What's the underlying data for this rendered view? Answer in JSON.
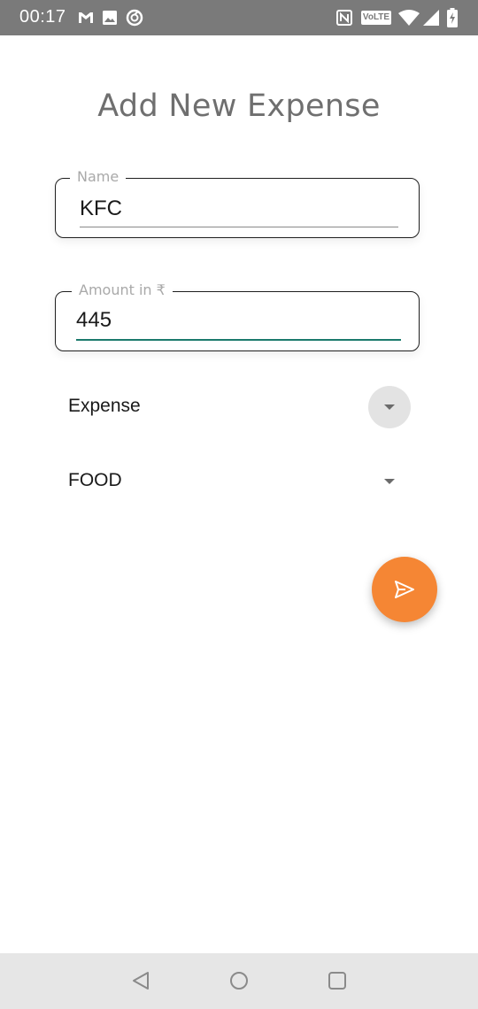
{
  "status_bar": {
    "time": "00:17",
    "volte": "VoLTE",
    "icons": [
      "gmail-icon",
      "image-icon",
      "sync-icon",
      "nfc-icon",
      "volte-icon",
      "wifi-icon",
      "signal-icon",
      "battery-charging-icon"
    ]
  },
  "page": {
    "title": "Add New Expense"
  },
  "form": {
    "name": {
      "label": "Name",
      "value": "KFC"
    },
    "amount": {
      "label": "Amount in ₹",
      "value": "445"
    },
    "type": {
      "selected": "Expense"
    },
    "category": {
      "selected": "FOOD"
    }
  },
  "fab": {
    "icon": "send-icon",
    "color": "#f58634"
  },
  "nav_bar": {
    "icons": [
      "back-icon",
      "home-icon",
      "recents-icon"
    ]
  },
  "colors": {
    "status_bar": "#7a7a7a",
    "accent_underline": "#1b7a6c",
    "nav_bar": "#e6e6e6"
  }
}
